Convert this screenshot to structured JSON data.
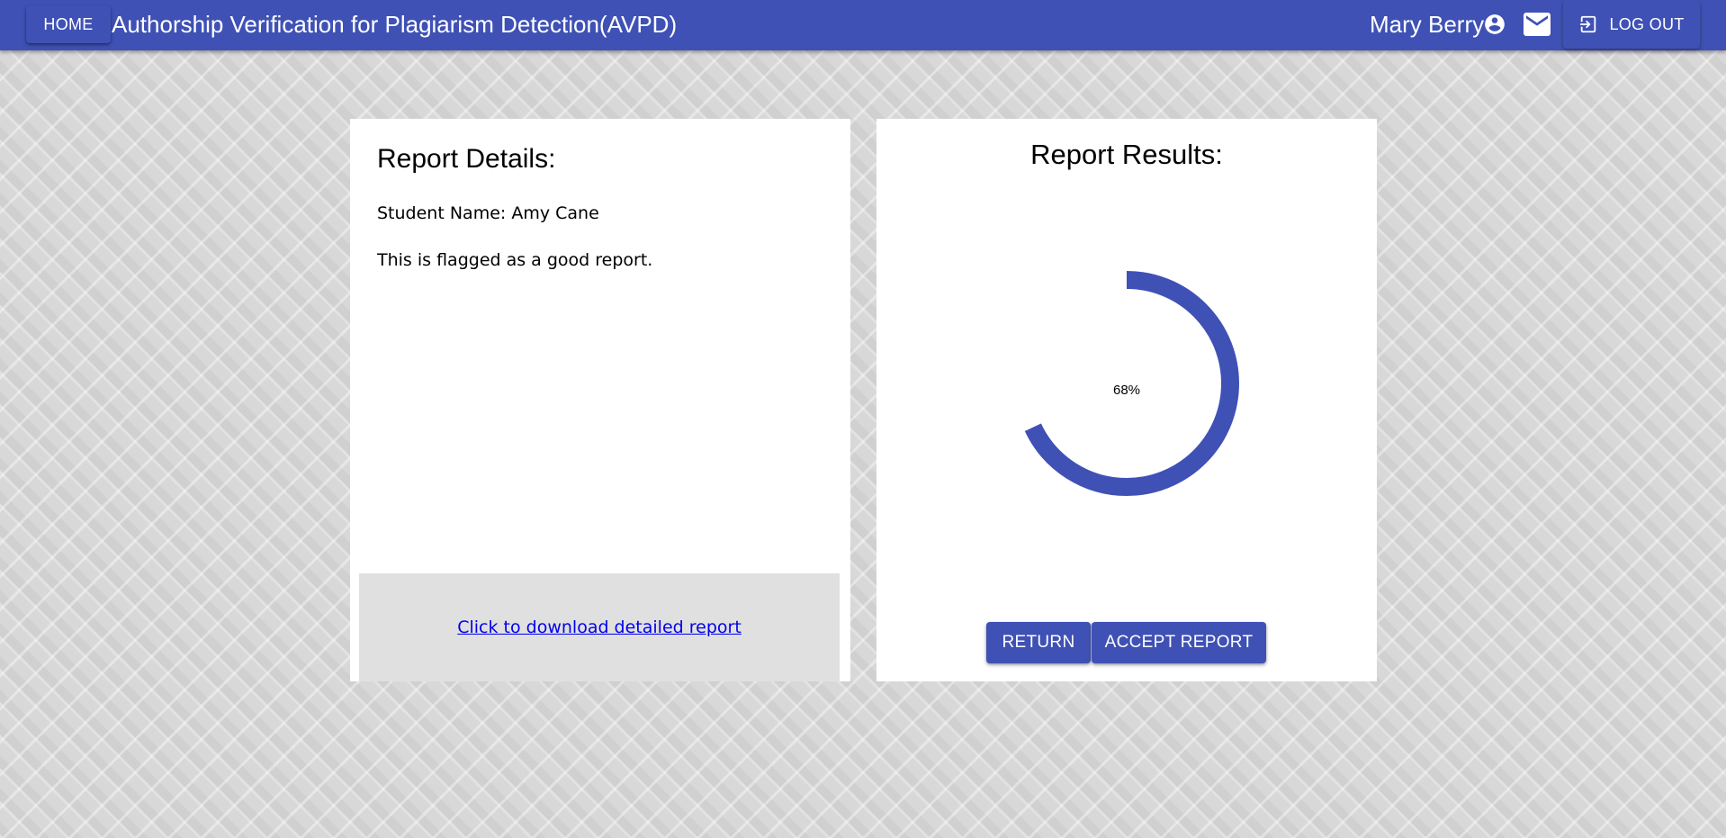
{
  "app_bar": {
    "home_label": "HOME",
    "title": "Authorship Verification for Plagiarism Detection(AVPD)",
    "user_name": "Mary Berry",
    "account_icon": "account-circle-icon",
    "mail_icon": "mail-icon",
    "logout_icon": "logout-icon",
    "logout_label": "LOG OUT",
    "color": "#3f51b5"
  },
  "details": {
    "title": "Report Details:",
    "student_name": "Student Name: Amy Cane",
    "flag_text": "This is flagged as a good report.",
    "download_link": "Click to download detailed report"
  },
  "results": {
    "title": "Report Results:",
    "score_label": "68%",
    "score_percent": 68,
    "gauge_color": "#3f51b5",
    "return_label": "RETURN",
    "accept_label": "ACCEPT REPORT"
  }
}
